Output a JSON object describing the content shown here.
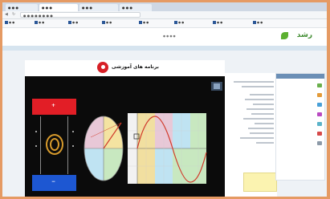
{
  "browser": {
    "tabs": [
      "● ● ●",
      "● ● ●",
      "● ● ●",
      "● ● ●"
    ],
    "url": "● ● ● ● ● ● ● ●",
    "bookmarks": [
      "● ●",
      "● ●",
      "● ●",
      "● ●",
      "● ●",
      "● ●",
      "● ●",
      "● ●"
    ]
  },
  "site": {
    "logo_text": "رشد",
    "menu_text": "● ● ● ●"
  },
  "viewer": {
    "title": "برنامه های آموزشی",
    "plus_sign": "+",
    "minus_sign": "−"
  },
  "colors": {
    "frame_bg": "#e59a63",
    "viewer_bg": "#0b0b0b",
    "red_plate": "#e21e26",
    "blue_plate": "#1d57d2",
    "wave": "#d13a2b"
  }
}
